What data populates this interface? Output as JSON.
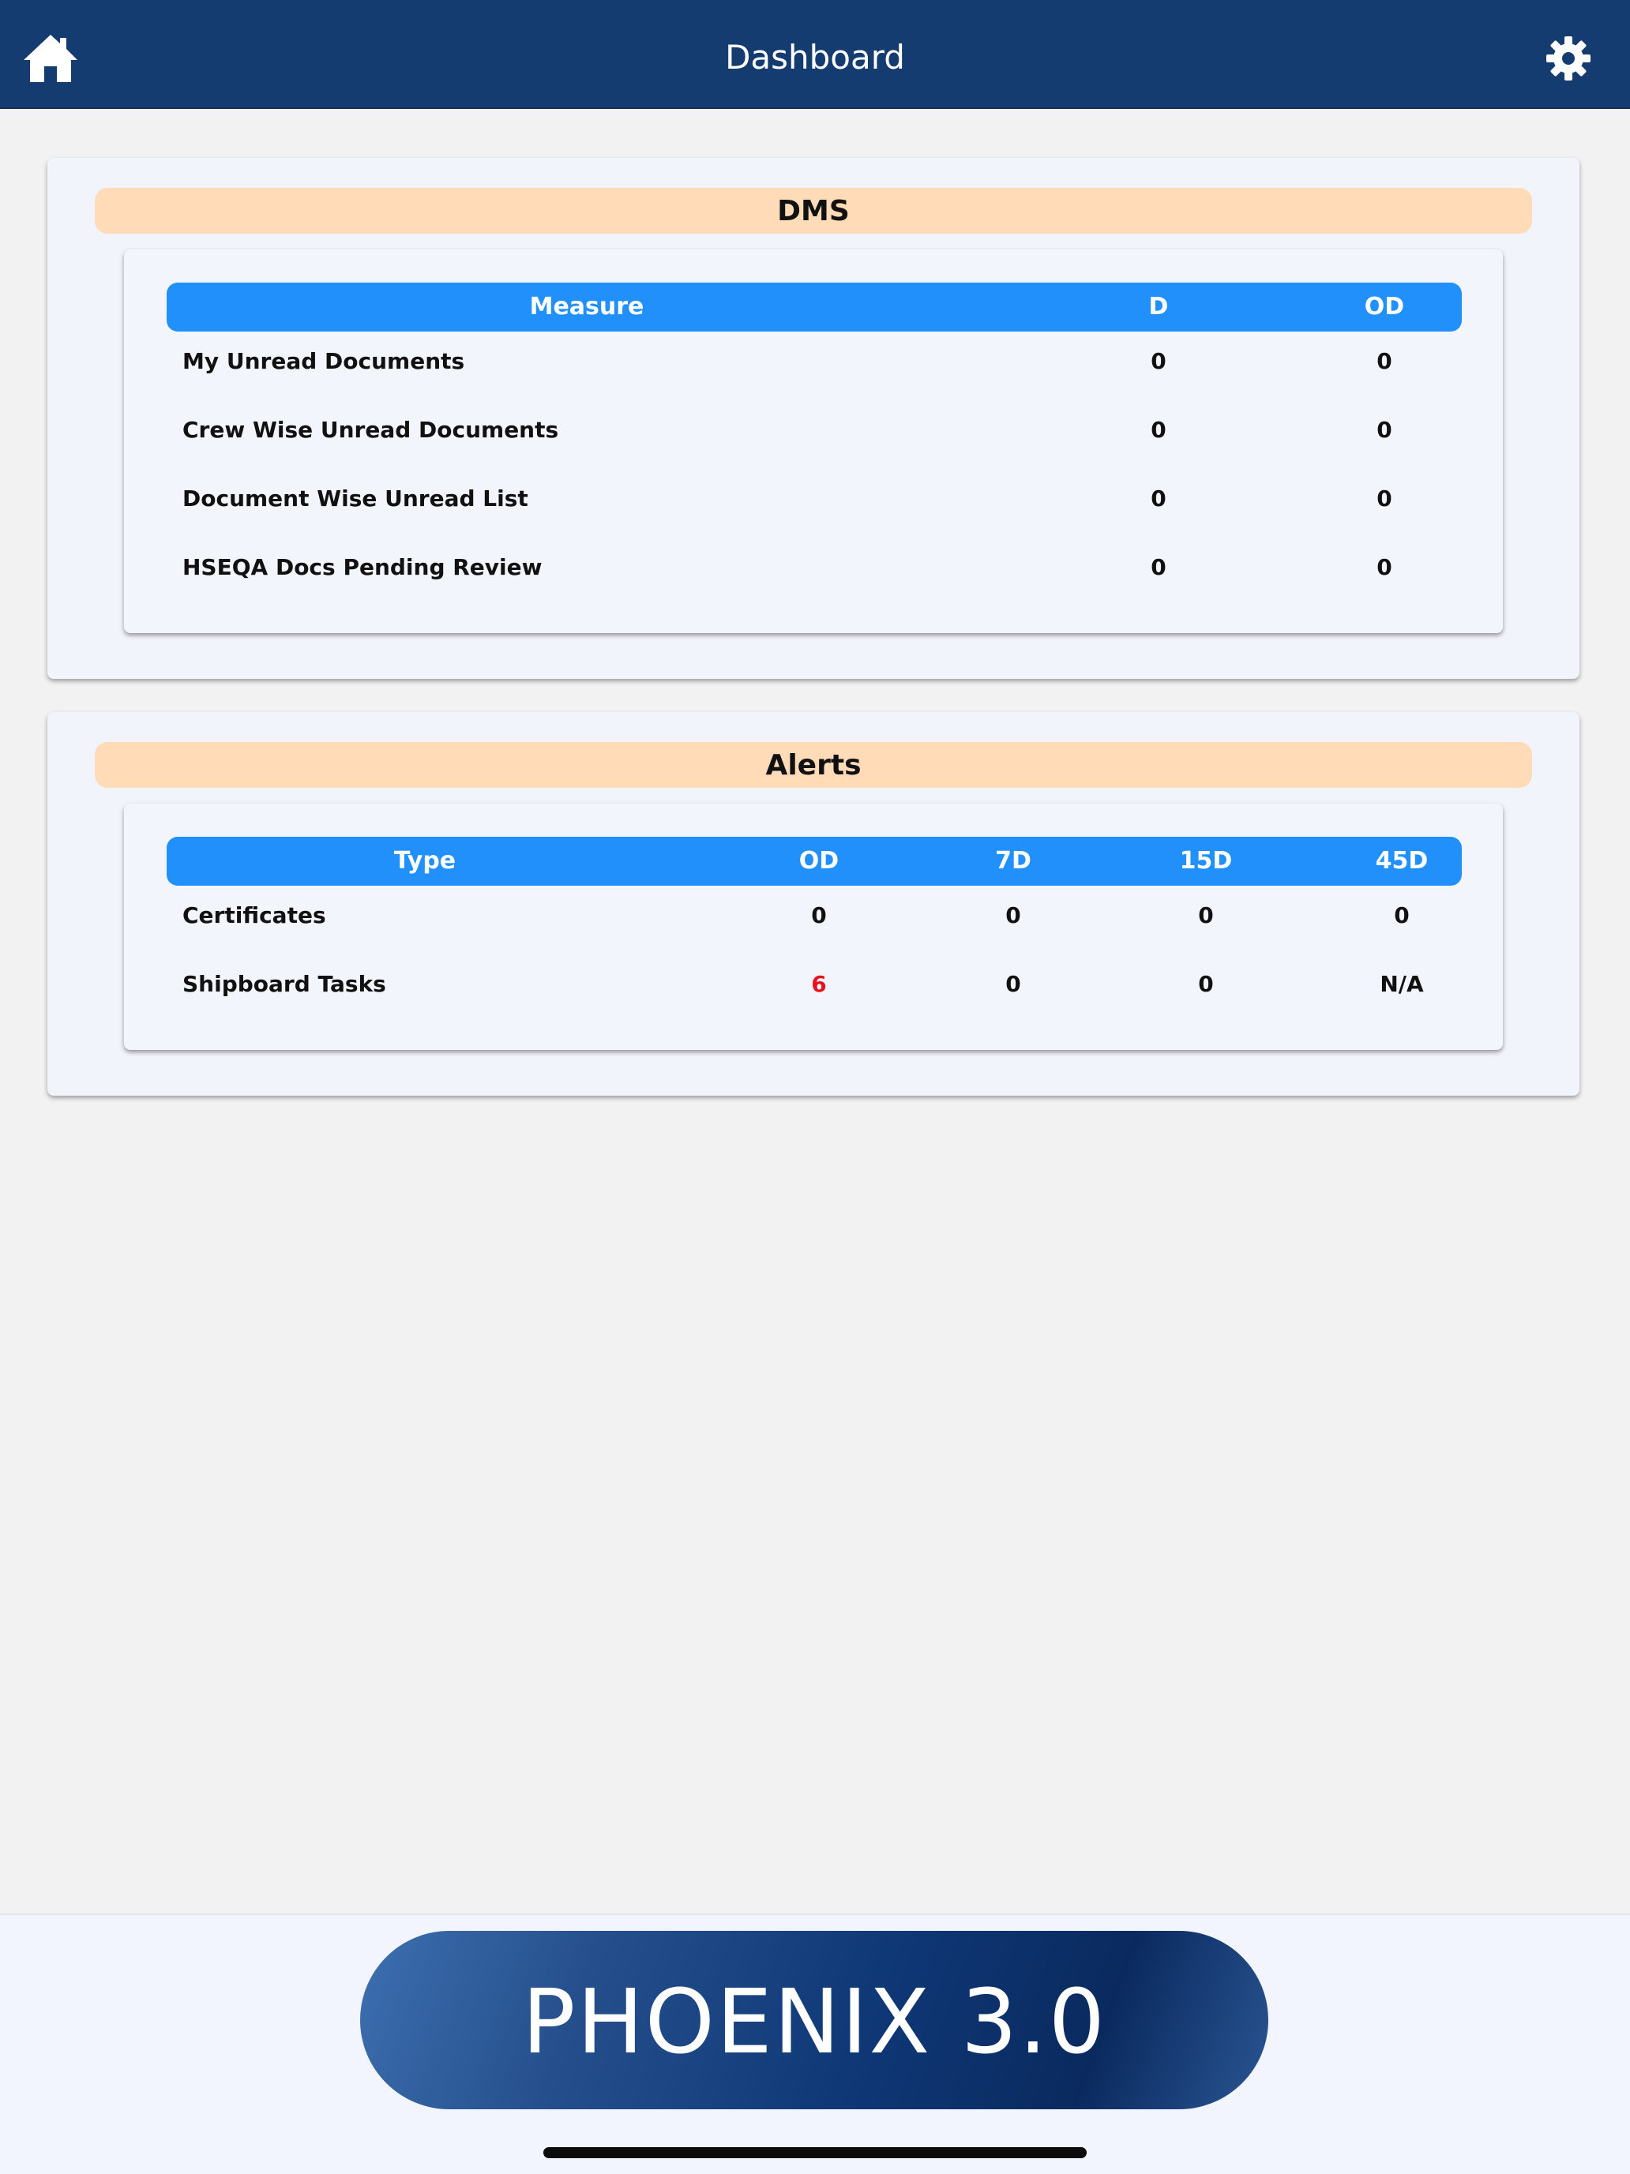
{
  "header": {
    "title": "Dashboard",
    "left_icon": "home-icon",
    "right_icon": "gear-icon",
    "bg_color": "#143c71"
  },
  "dms": {
    "title": "DMS",
    "columns": [
      "Measure",
      "D",
      "OD"
    ],
    "rows": [
      {
        "measure": "My Unread Documents",
        "d": "0",
        "od": "0"
      },
      {
        "measure": "Crew Wise Unread Documents",
        "d": "0",
        "od": "0"
      },
      {
        "measure": "Document Wise Unread List",
        "d": "0",
        "od": "0"
      },
      {
        "measure": "HSEQA Docs Pending Review",
        "d": "0",
        "od": "0"
      }
    ]
  },
  "alerts": {
    "title": "Alerts",
    "columns": [
      "Type",
      "OD",
      "7D",
      "15D",
      "45D"
    ],
    "rows": [
      {
        "type": "Certificates",
        "od": "0",
        "d7": "0",
        "d15": "0",
        "d45": "0"
      },
      {
        "type": "Shipboard Tasks",
        "od": "6",
        "d7": "0",
        "d15": "0",
        "d45": "N/A"
      }
    ],
    "highlight_color": "#e8121c"
  },
  "footer": {
    "brand": "PHOENIX 3.0"
  },
  "colors": {
    "section_header": "#ffdbb7",
    "table_header": "#2190fb"
  }
}
